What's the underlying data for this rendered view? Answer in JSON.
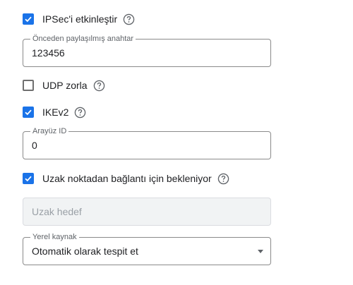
{
  "ipsec": {
    "label": "IPSec'i etkinleştir",
    "checked": true
  },
  "psk": {
    "legend": "Önceden paylaşılmış anahtar",
    "value": "123456"
  },
  "udp": {
    "label": "UDP zorla",
    "checked": false
  },
  "ikev2": {
    "label": "IKEv2",
    "checked": true
  },
  "interface_id": {
    "legend": "Arayüz ID",
    "value": "0"
  },
  "wait_remote": {
    "label": "Uzak noktadan bağlantı için bekleniyor",
    "checked": true
  },
  "remote_target": {
    "placeholder": "Uzak hedef"
  },
  "local_source": {
    "legend": "Yerel kaynak",
    "selected": "Otomatik olarak tespit et"
  },
  "colors": {
    "accent": "#1a73e8",
    "border": "#8a8a8a",
    "disabled_bg": "#f1f3f4"
  },
  "icons": {
    "help": "help-circle-icon",
    "check": "check-icon",
    "dropdown": "dropdown-arrow-icon"
  }
}
